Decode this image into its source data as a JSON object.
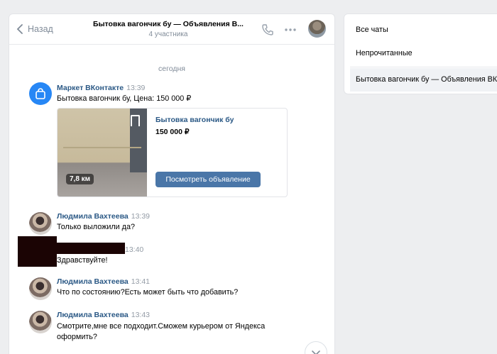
{
  "header": {
    "back_label": "Назад",
    "title": "Бытовка вагончик бу — Объявления В...",
    "subtitle": "4 участника"
  },
  "date_separator": "сегодня",
  "messages": [
    {
      "author": "Маркет ВКонтакте",
      "time": "13:39",
      "text": "Бытовка вагончик бу, Цена: 150 000 ₽",
      "card": {
        "title": "Бытовка вагончик бу",
        "price": "150 000 ₽",
        "distance": "7,8 км",
        "button_label": "Посмотреть объявление"
      }
    },
    {
      "author": "Людмила Вахтеева",
      "time": "13:39",
      "text": "Только выложили да?"
    },
    {
      "author": "",
      "time": "13:40",
      "text": "Здравствуйте!"
    },
    {
      "author": "Людмила Вахтеева",
      "time": "13:41",
      "text": "Что по состоянию?Есть может быть что добавить?"
    },
    {
      "author": "Людмила Вахтеева",
      "time": "13:43",
      "text_line1": "Смотрите,мне все подходит.Сможем курьером от Яндекса",
      "text_line2": "оформить?"
    }
  ],
  "folders": [
    {
      "label": "Все чаты"
    },
    {
      "label": "Непрочитанные"
    },
    {
      "label": "Бытовка вагончик бу — Объявления ВК"
    }
  ],
  "colors": {
    "accent_link": "#2a5885",
    "button_blue": "#4a76a8",
    "market_blue": "#2787f5",
    "background": "#edeef0"
  },
  "icons": [
    "chevron-left-icon",
    "phone-icon",
    "more-dots-icon",
    "shopping-bag-icon",
    "bookmark-icon",
    "chevron-down-icon"
  ]
}
